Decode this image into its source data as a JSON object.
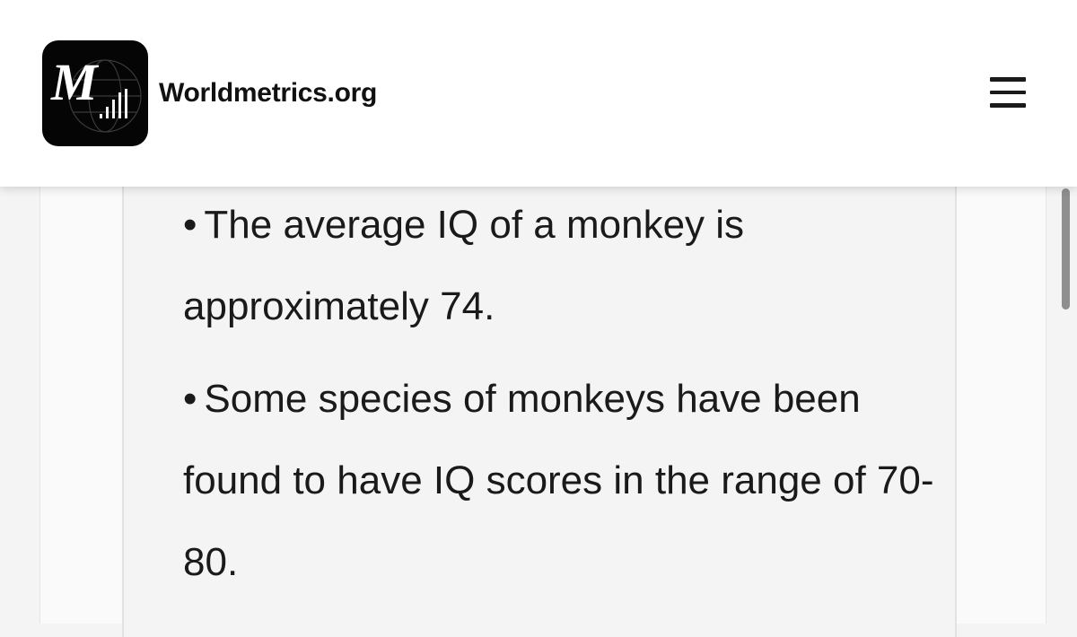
{
  "header": {
    "brand": "Worldmetrics.org",
    "logo_letter": "M",
    "logo_icon": "worldmetrics-logo-icon",
    "menu_icon": "hamburger-menu-icon"
  },
  "content": {
    "bullet": "•",
    "items": [
      "The average IQ of a monkey is approximately 74.",
      "Some species of monkeys have been found to have IQ scores in the range of 70-80."
    ]
  },
  "colors": {
    "header_bg": "#ffffff",
    "logo_bg": "#050505",
    "text": "#1a1a1a",
    "card_bg": "#f4f4f5",
    "scrollbar": "#8f8f8f"
  }
}
